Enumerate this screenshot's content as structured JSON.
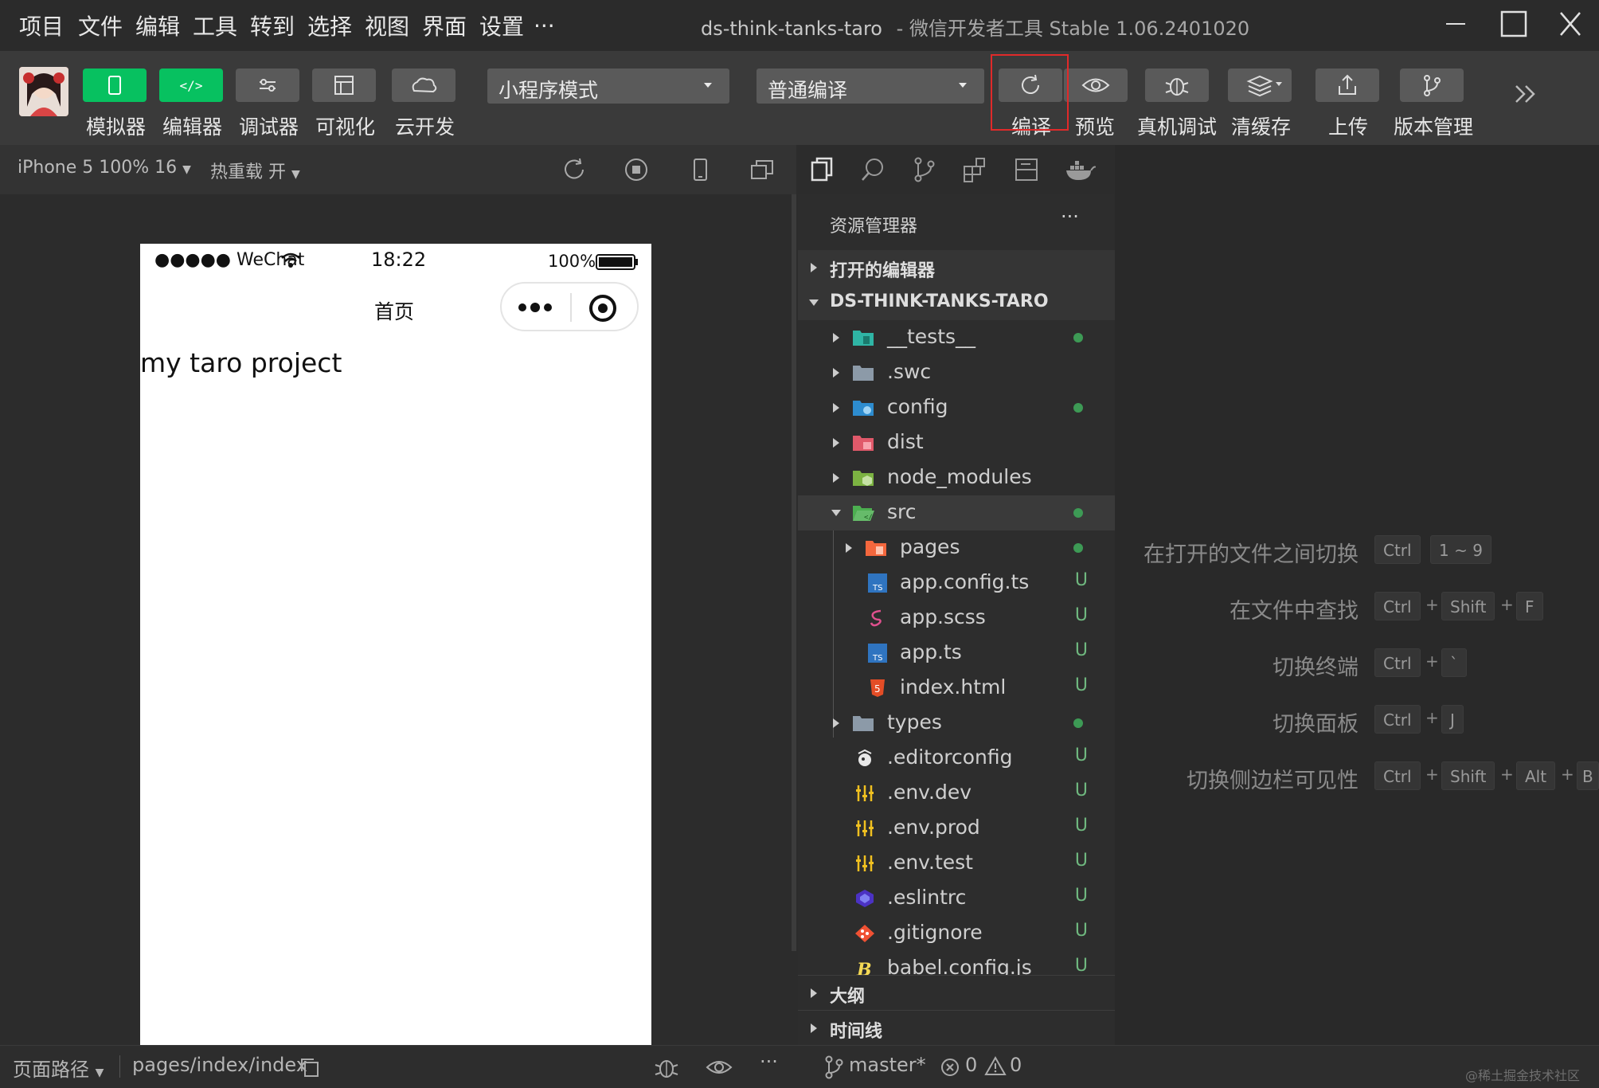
{
  "window": {
    "menu": [
      "项目",
      "文件",
      "编辑",
      "工具",
      "转到",
      "选择",
      "视图",
      "界面",
      "设置",
      "..."
    ],
    "title": "ds-think-tanks-taro",
    "title_app": "- 微信开发者工具 Stable 1.06.2401020"
  },
  "toolbar": {
    "simulator": "模拟器",
    "editor": "编辑器",
    "debugger": "调试器",
    "visual": "可视化",
    "cloud": "云开发",
    "mode_select": "小程序模式",
    "compile_select": "普通编译",
    "compile": "编译",
    "preview": "预览",
    "remote_debug": "真机调试",
    "clear_cache": "清缓存",
    "upload": "上传",
    "version": "版本管理"
  },
  "simulator": {
    "device": "iPhone 5 100% 16",
    "hot_reload": "热重载 开",
    "status_carrier": "●●●●● WeChat",
    "status_time": "18:22",
    "status_battery": "100%",
    "nav_title": "首页",
    "page_text": "my taro project"
  },
  "explorer": {
    "header": "资源管理器",
    "more": "···",
    "open_editors": "打开的编辑器",
    "project": "DS-THINK-TANKS-TARO",
    "items": [
      {
        "name": "__tests__",
        "status": "dot"
      },
      {
        "name": ".swc",
        "status": ""
      },
      {
        "name": "config",
        "status": "dot"
      },
      {
        "name": "dist",
        "status": ""
      },
      {
        "name": "node_modules",
        "status": ""
      },
      {
        "name": "src",
        "status": "dot"
      },
      {
        "name": "pages",
        "status": "dot"
      },
      {
        "name": "app.config.ts",
        "status": "U"
      },
      {
        "name": "app.scss",
        "status": "U"
      },
      {
        "name": "app.ts",
        "status": "U"
      },
      {
        "name": "index.html",
        "status": "U"
      },
      {
        "name": "types",
        "status": "dot"
      },
      {
        "name": ".editorconfig",
        "status": "U"
      },
      {
        "name": ".env.dev",
        "status": "U"
      },
      {
        "name": ".env.prod",
        "status": "U"
      },
      {
        "name": ".env.test",
        "status": "U"
      },
      {
        "name": ".eslintrc",
        "status": "U"
      },
      {
        "name": ".gitignore",
        "status": "U"
      },
      {
        "name": "babel.config.js",
        "status": "U"
      }
    ],
    "outline": "大纲",
    "timeline": "时间线"
  },
  "shortcuts": [
    {
      "label": "在打开的文件之间切换",
      "keys": [
        "Ctrl",
        "1 ~ 9"
      ]
    },
    {
      "label": "在文件中查找",
      "keys": [
        "Ctrl",
        "+",
        "Shift",
        "+",
        "F"
      ]
    },
    {
      "label": "切换终端",
      "keys": [
        "Ctrl",
        "+",
        "`"
      ]
    },
    {
      "label": "切换面板",
      "keys": [
        "Ctrl",
        "+",
        "J"
      ]
    },
    {
      "label": "切换侧边栏可见性",
      "keys": [
        "Ctrl",
        "+",
        "Shift",
        "+",
        "Alt",
        "+",
        "B"
      ]
    }
  ],
  "status": {
    "page_path_label": "页面路径",
    "page_path": "pages/index/index",
    "branch": "master*",
    "errors": "0",
    "warnings": "0",
    "watermark": "@稀土掘金技术社区"
  },
  "colors": {
    "accent_green": "#07c160",
    "highlight_red": "#e02a2a",
    "untracked": "#6fb87f"
  }
}
